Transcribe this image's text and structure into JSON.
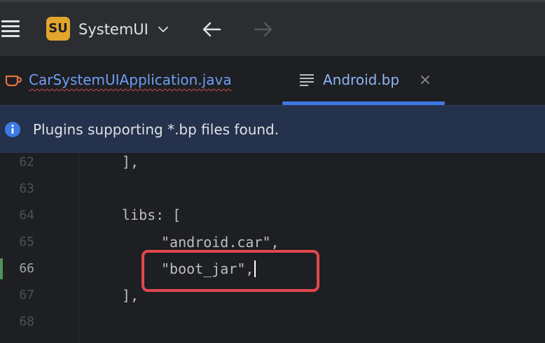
{
  "titlebar": {
    "project_badge": "SU",
    "project_name": "SystemUI",
    "icons": {
      "menu": "hamburger-menu-icon",
      "project_dropdown": "chevron-down-icon",
      "back": "arrow-left-icon",
      "forward": "arrow-right-icon"
    }
  },
  "tabs": [
    {
      "label": "CarSystemUIApplication.java",
      "icon": "java-cup-icon",
      "active": false
    },
    {
      "label": "Android.bp",
      "icon": "text-file-icon",
      "active": true,
      "close_icon": "close-icon"
    }
  ],
  "banner": {
    "icon": "info-icon",
    "text": "Plugins supporting *.bp files found."
  },
  "editor": {
    "lines": [
      {
        "number": "62",
        "code": "],"
      },
      {
        "number": "63",
        "code": ""
      },
      {
        "number": "64",
        "code": "libs: ["
      },
      {
        "number": "65",
        "code": "\"android.car\","
      },
      {
        "number": "66",
        "code": "\"boot_jar\",",
        "current": true,
        "modified": true
      },
      {
        "number": "67",
        "code": "],"
      },
      {
        "number": "68",
        "code": ""
      }
    ]
  },
  "colors": {
    "accent": "#3d7ae7",
    "badge": "#e2a62c",
    "highlight": "#e0484d",
    "banner_bg": "#25324d",
    "modified_marker": "#549159"
  }
}
